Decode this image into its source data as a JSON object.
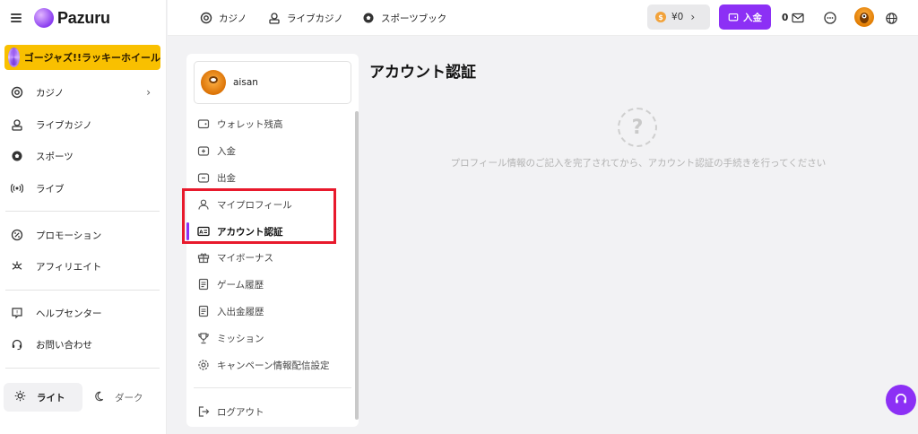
{
  "brand": {
    "name": "Pazuru"
  },
  "banner": {
    "text": "ゴージャズ!!ラッキーホイール"
  },
  "sidebar": {
    "items": [
      {
        "label": "カジノ",
        "icon": "casino-chip-icon"
      },
      {
        "label": "ライブカジノ",
        "icon": "dealer-icon"
      },
      {
        "label": "スポーツ",
        "icon": "soccer-ball-icon"
      },
      {
        "label": "ライブ",
        "icon": "broadcast-icon"
      },
      {
        "label": "プロモーション",
        "icon": "promotion-icon"
      },
      {
        "label": "アフィリエイト",
        "icon": "network-icon"
      },
      {
        "label": "ヘルプセンター",
        "icon": "help-icon"
      },
      {
        "label": "お問い合わせ",
        "icon": "headset-icon"
      }
    ],
    "theme": {
      "light": "ライト",
      "dark": "ダーク"
    }
  },
  "topbar": {
    "nav": [
      {
        "label": "カジノ",
        "icon": "casino-chip-icon"
      },
      {
        "label": "ライブカジノ",
        "icon": "dealer-icon"
      },
      {
        "label": "スポーツブック",
        "icon": "soccer-ball-icon"
      }
    ],
    "balance": "¥0",
    "deposit": "入金",
    "message_count": "0"
  },
  "account": {
    "username": "aisan",
    "menu": [
      {
        "label": "ウォレット残高",
        "icon": "wallet-icon"
      },
      {
        "label": "入金",
        "icon": "deposit-icon"
      },
      {
        "label": "出金",
        "icon": "withdraw-icon"
      },
      {
        "label": "マイプロフィール",
        "icon": "user-icon"
      },
      {
        "label": "アカウント認証",
        "icon": "id-card-icon",
        "active": true
      },
      {
        "label": "マイボーナス",
        "icon": "gift-icon"
      },
      {
        "label": "ゲーム履歴",
        "icon": "document-icon"
      },
      {
        "label": "入出金履歴",
        "icon": "document-icon"
      },
      {
        "label": "ミッション",
        "icon": "trophy-icon"
      },
      {
        "label": "キャンペーン情報配信設定",
        "icon": "gear-icon"
      }
    ],
    "logout": "ログアウト"
  },
  "main": {
    "title": "アカウント認証",
    "message": "プロフィール情報のご記入を完了されてから、アカウント認証の手続きを行ってください"
  },
  "colors": {
    "accent": "#8c30f5",
    "banner": "#f9c000",
    "highlight": "#e8192c"
  }
}
